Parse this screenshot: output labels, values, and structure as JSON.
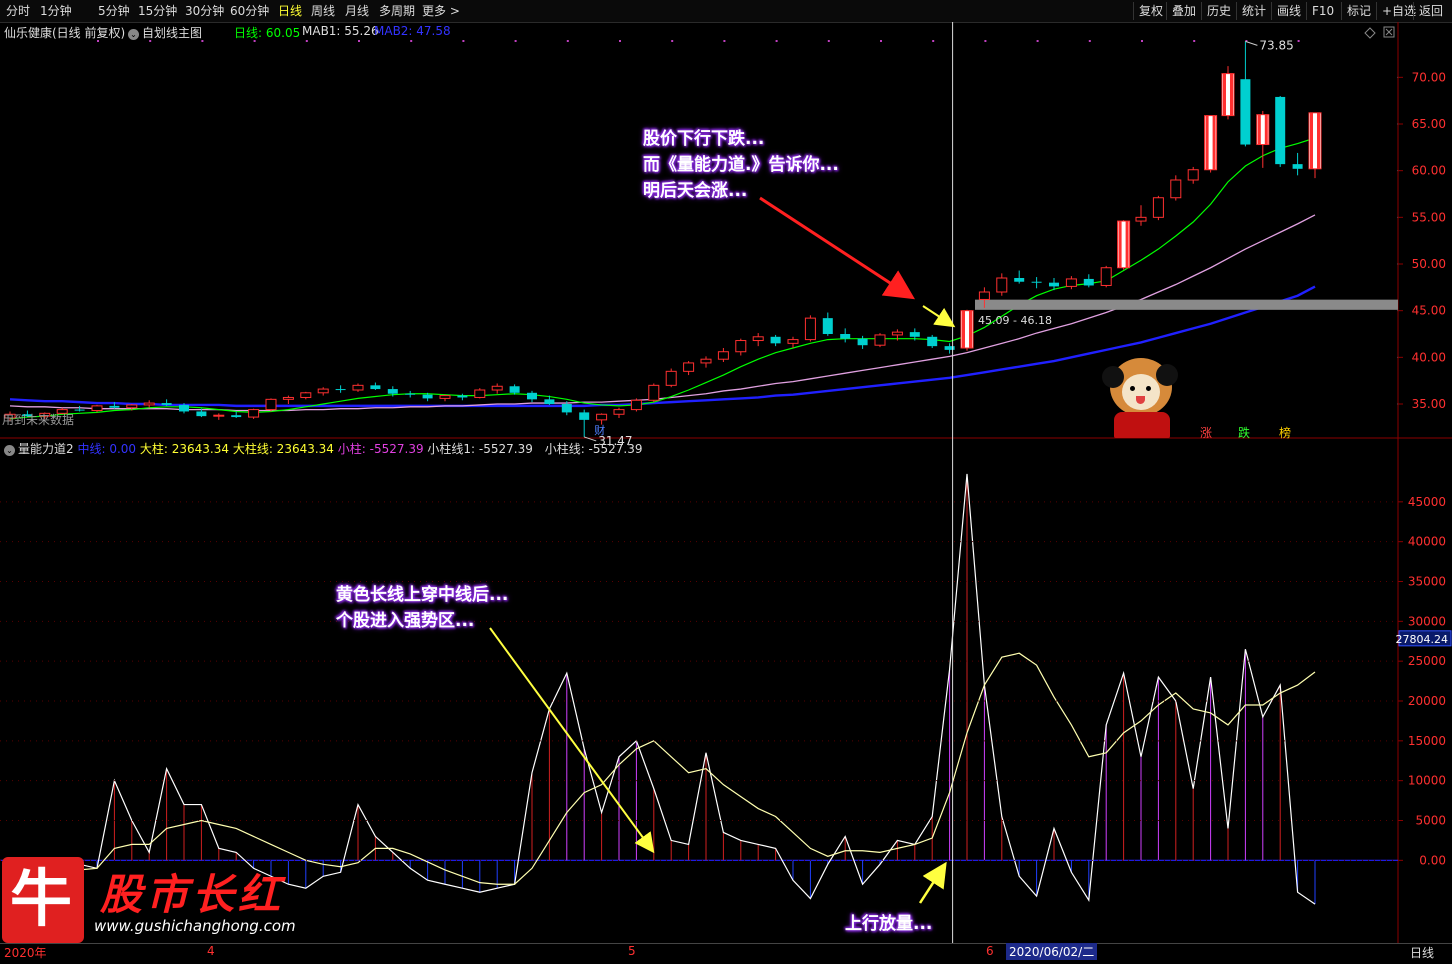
{
  "toolbar": {
    "periods": [
      "分时",
      "1分钟",
      "5分钟",
      "15分钟",
      "30分钟",
      "60分钟",
      "日线",
      "周线",
      "月线",
      "多周期",
      "更多 >"
    ],
    "active": "日线",
    "right": [
      "复权",
      "叠加",
      "历史",
      "统计",
      "画线",
      "F10",
      "标记",
      "+自选",
      "返回"
    ]
  },
  "main_header": {
    "stock": "仙乐健康(日线 前复权)",
    "template": "自划线主图",
    "day_label": "日线:",
    "day_value": "60.05",
    "mab1": "MAB1: 55.26",
    "mab2": "MAB2: 47.58"
  },
  "indicator_header": {
    "name": "量能力道2",
    "mid_label": "中线: 0.00",
    "big_bar": "大柱: 23643.34",
    "big_line": "大柱线: 23643.34",
    "small_bar": "小柱: -5527.39",
    "small_line1": "小柱线1: -5527.39",
    "small_line": "小柱线: -5527.39"
  },
  "labels": {
    "future_data": "用到未来数据",
    "high_mark": "73.85",
    "low_mark": "31.47",
    "cai": "财",
    "range": "45.09 - 46.18",
    "zhang": "涨",
    "die": "跌",
    "bang": "榜",
    "current_indicator": "27804.24",
    "date_year": "2020年",
    "m4": "4",
    "m5": "5",
    "m6": "6",
    "cursor_date": "2020/06/02/二",
    "bottom_right": "日线"
  },
  "annotations": {
    "price_note": [
      "股价下行下跌...",
      "而《量能力道.》告诉你...",
      "明后天会涨..."
    ],
    "yellow_note": [
      "黄色长线上穿中线后...",
      "个股进入强势区..."
    ],
    "up_volume": "上行放量..."
  },
  "logo": {
    "char": "牛",
    "name": "股市长红",
    "url": "www.gushichanghong.com"
  },
  "colors": {
    "up": "#ff3030",
    "down": "#00d0d0",
    "ma_green": "#00ff00",
    "ma_pink": "#e0a0e0",
    "ma_blue": "#2020ff",
    "yellow": "#ffff40"
  },
  "chart_data": [
    {
      "type": "candlestick",
      "title": "仙乐健康(日线 前复权)",
      "ylim": [
        32,
        74
      ],
      "yticks": [
        35,
        40,
        45,
        50,
        55,
        60,
        65,
        70
      ],
      "candles": [
        [
          33.5,
          34.2,
          33.2,
          33.9
        ],
        [
          33.9,
          34.3,
          33.6,
          33.7
        ],
        [
          33.7,
          34.1,
          33.4,
          34.0
        ],
        [
          34.0,
          34.6,
          33.9,
          34.4
        ],
        [
          34.4,
          34.8,
          34.2,
          34.3
        ],
        [
          34.3,
          34.9,
          34.1,
          34.8
        ],
        [
          34.8,
          35.2,
          34.5,
          34.6
        ],
        [
          34.6,
          35.0,
          34.3,
          34.9
        ],
        [
          34.9,
          35.4,
          34.6,
          35.1
        ],
        [
          35.1,
          35.5,
          34.8,
          34.9
        ],
        [
          34.9,
          35.1,
          34.0,
          34.2
        ],
        [
          34.2,
          34.5,
          33.6,
          33.7
        ],
        [
          33.7,
          34.0,
          33.3,
          33.8
        ],
        [
          33.8,
          34.2,
          33.5,
          33.6
        ],
        [
          33.6,
          34.5,
          33.4,
          34.4
        ],
        [
          34.4,
          35.6,
          34.2,
          35.5
        ],
        [
          35.5,
          35.9,
          35.0,
          35.7
        ],
        [
          35.7,
          36.3,
          35.5,
          36.2
        ],
        [
          36.2,
          36.8,
          35.9,
          36.6
        ],
        [
          36.6,
          37.0,
          36.2,
          36.5
        ],
        [
          36.5,
          37.2,
          36.3,
          37.0
        ],
        [
          37.0,
          37.3,
          36.5,
          36.6
        ],
        [
          36.6,
          36.9,
          35.8,
          36.1
        ],
        [
          36.1,
          36.4,
          35.7,
          36.0
        ],
        [
          36.0,
          36.2,
          35.3,
          35.6
        ],
        [
          35.6,
          36.0,
          35.3,
          35.9
        ],
        [
          35.9,
          36.1,
          35.4,
          35.7
        ],
        [
          35.7,
          36.7,
          35.6,
          36.5
        ],
        [
          36.5,
          37.2,
          36.1,
          36.9
        ],
        [
          36.9,
          37.1,
          36.0,
          36.2
        ],
        [
          36.2,
          36.4,
          35.2,
          35.5
        ],
        [
          35.5,
          35.9,
          34.9,
          35.0
        ],
        [
          35.0,
          35.3,
          33.8,
          34.1
        ],
        [
          34.1,
          34.4,
          31.47,
          33.3
        ],
        [
          33.3,
          34.0,
          32.8,
          33.9
        ],
        [
          33.9,
          34.6,
          33.5,
          34.4
        ],
        [
          34.4,
          35.6,
          34.2,
          35.4
        ],
        [
          35.4,
          37.2,
          35.2,
          37.0
        ],
        [
          37.0,
          38.8,
          36.8,
          38.5
        ],
        [
          38.5,
          39.6,
          38.1,
          39.4
        ],
        [
          39.4,
          40.1,
          38.9,
          39.8
        ],
        [
          39.8,
          41.0,
          39.5,
          40.6
        ],
        [
          40.6,
          42.0,
          40.2,
          41.8
        ],
        [
          41.8,
          42.6,
          41.2,
          42.2
        ],
        [
          42.2,
          42.4,
          41.2,
          41.5
        ],
        [
          41.5,
          42.2,
          41.0,
          41.9
        ],
        [
          41.9,
          44.5,
          41.7,
          44.2
        ],
        [
          44.2,
          44.8,
          42.3,
          42.5
        ],
        [
          42.5,
          43.1,
          41.6,
          42.0
        ],
        [
          42.0,
          42.3,
          40.9,
          41.3
        ],
        [
          41.3,
          42.6,
          41.1,
          42.4
        ],
        [
          42.4,
          43.0,
          41.8,
          42.7
        ],
        [
          42.7,
          43.1,
          41.8,
          42.2
        ],
        [
          42.2,
          42.4,
          41.0,
          41.2
        ],
        [
          41.2,
          41.5,
          40.4,
          40.8
        ],
        [
          41.0,
          45.1,
          40.7,
          45.0
        ],
        [
          46.2,
          47.5,
          45.3,
          47.0
        ],
        [
          47.0,
          49.0,
          46.6,
          48.5
        ],
        [
          48.5,
          49.3,
          47.9,
          48.1
        ],
        [
          48.1,
          48.6,
          47.4,
          48.0
        ],
        [
          48.0,
          48.5,
          47.2,
          47.6
        ],
        [
          47.6,
          48.7,
          47.3,
          48.4
        ],
        [
          48.4,
          48.9,
          47.5,
          47.7
        ],
        [
          47.7,
          49.8,
          47.5,
          49.6
        ],
        [
          49.6,
          54.7,
          49.4,
          54.6
        ],
        [
          54.6,
          56.3,
          54.1,
          55.0
        ],
        [
          55.0,
          57.3,
          54.7,
          57.1
        ],
        [
          57.1,
          59.5,
          56.8,
          59.0
        ],
        [
          59.0,
          60.4,
          58.6,
          60.1
        ],
        [
          60.1,
          65.9,
          59.8,
          65.9
        ],
        [
          65.9,
          71.2,
          65.5,
          70.4
        ],
        [
          69.8,
          73.85,
          62.6,
          62.8
        ],
        [
          62.8,
          66.4,
          60.3,
          66.0
        ],
        [
          67.9,
          68.0,
          60.4,
          60.7
        ],
        [
          60.7,
          61.9,
          59.5,
          60.2
        ],
        [
          60.2,
          66.2,
          59.2,
          66.2
        ]
      ],
      "series": [
        {
          "name": "MAB1",
          "values": [
            33.4,
            33.6,
            33.7,
            33.9,
            34.0,
            34.1,
            34.3,
            34.4,
            34.6,
            34.7,
            34.7,
            34.6,
            34.4,
            34.2,
            34.1,
            34.2,
            34.4,
            34.7,
            35.0,
            35.3,
            35.6,
            35.8,
            36.0,
            36.1,
            36.1,
            36.0,
            35.9,
            35.9,
            36.0,
            36.1,
            36.0,
            35.8,
            35.5,
            35.1,
            34.9,
            34.8,
            34.9,
            35.2,
            35.8,
            36.5,
            37.3,
            38.1,
            39.0,
            39.8,
            40.5,
            41.0,
            41.5,
            41.9,
            42.0,
            42.0,
            42.0,
            42.0,
            42.0,
            41.9,
            41.7,
            42.3,
            43.2,
            44.4,
            45.6,
            46.6,
            47.3,
            47.7,
            47.9,
            48.2,
            49.3,
            50.4,
            51.6,
            53.0,
            54.5,
            56.4,
            58.8,
            60.5,
            61.6,
            62.4,
            62.9,
            63.5
          ]
        },
        {
          "name": "MAB2",
          "values": [
            34.8,
            34.7,
            34.7,
            34.6,
            34.6,
            34.5,
            34.5,
            34.5,
            34.5,
            34.5,
            34.4,
            34.4,
            34.4,
            34.3,
            34.3,
            34.3,
            34.3,
            34.4,
            34.4,
            34.5,
            34.5,
            34.6,
            34.6,
            34.7,
            34.7,
            34.8,
            34.8,
            34.9,
            35.0,
            35.0,
            35.1,
            35.1,
            35.1,
            35.2,
            35.2,
            35.3,
            35.4,
            35.5,
            35.7,
            35.9,
            36.1,
            36.4,
            36.6,
            36.9,
            37.2,
            37.4,
            37.7,
            38.0,
            38.3,
            38.6,
            38.9,
            39.2,
            39.5,
            39.8,
            40.1,
            40.5,
            41.0,
            41.5,
            42.0,
            42.6,
            43.1,
            43.6,
            44.2,
            44.8,
            45.5,
            46.2,
            47.0,
            47.8,
            48.7,
            49.6,
            50.6,
            51.6,
            52.5,
            53.4,
            54.3,
            55.26
          ]
        },
        {
          "name": "日线",
          "values": [
            35.5,
            35.4,
            35.3,
            35.3,
            35.2,
            35.1,
            35.1,
            35.0,
            35.0,
            34.9,
            34.9,
            34.9,
            34.9,
            34.8,
            34.8,
            34.8,
            34.8,
            34.8,
            34.8,
            34.8,
            34.8,
            34.8,
            34.8,
            34.8,
            34.8,
            34.8,
            34.8,
            34.8,
            34.8,
            34.8,
            34.8,
            34.8,
            34.8,
            34.8,
            34.9,
            34.9,
            35.0,
            35.1,
            35.2,
            35.3,
            35.4,
            35.5,
            35.6,
            35.7,
            35.9,
            36.0,
            36.2,
            36.4,
            36.6,
            36.8,
            37.0,
            37.2,
            37.4,
            37.6,
            37.8,
            38.1,
            38.4,
            38.7,
            39.0,
            39.3,
            39.6,
            40.0,
            40.4,
            40.8,
            41.2,
            41.6,
            42.1,
            42.6,
            43.1,
            43.6,
            44.2,
            44.8,
            45.4,
            46.0,
            46.6,
            47.58
          ]
        }
      ]
    },
    {
      "type": "bar",
      "title": "量能力道2",
      "ylim": [
        -10000,
        50000
      ],
      "yticks": [
        0,
        5000,
        10000,
        15000,
        20000,
        25000,
        30000,
        35000,
        40000,
        45000
      ],
      "values": [
        -2500,
        -2000,
        -1500,
        -1000,
        -500,
        -1000,
        10000,
        5000,
        1000,
        11500,
        7000,
        7000,
        1500,
        1000,
        -1000,
        -2000,
        -3000,
        -3500,
        -2000,
        -1500,
        7000,
        3000,
        1000,
        -1000,
        -2500,
        -3000,
        -3500,
        -4000,
        -3500,
        -3000,
        11000,
        19000,
        23500,
        14000,
        6000,
        13000,
        15000,
        9000,
        2500,
        2000,
        13500,
        3500,
        2500,
        2000,
        1500,
        -2500,
        -4800,
        -500,
        3000,
        -3000,
        -500,
        2500,
        2000,
        5500,
        24000,
        48500,
        22000,
        5500,
        -2000,
        -4500,
        4000,
        -1500,
        -5000,
        17000,
        23500,
        13000,
        23000,
        20000,
        9000,
        23000,
        4000,
        26500,
        18000,
        22000,
        -4000,
        -5500
      ],
      "series": [
        {
          "name": "大柱线",
          "values": [
            -2000,
            -1800,
            -1600,
            -1400,
            -1200,
            -1000,
            1500,
            2000,
            2000,
            4000,
            4500,
            5000,
            4500,
            4000,
            3000,
            2000,
            1000,
            0,
            -500,
            -800,
            -300,
            1500,
            1500,
            800,
            -200,
            -1200,
            -2000,
            -2800,
            -3000,
            -3000,
            -1000,
            2500,
            6000,
            8500,
            9500,
            12000,
            14000,
            15000,
            13000,
            11000,
            11500,
            9500,
            8000,
            6500,
            5500,
            3500,
            1500,
            500,
            1200,
            1200,
            1000,
            1500,
            2000,
            2800,
            8500,
            16000,
            22000,
            25500,
            26000,
            24500,
            20500,
            17000,
            13000,
            13500,
            16000,
            17500,
            19500,
            21000,
            19000,
            18500,
            17000,
            19500,
            19500,
            21000,
            22000,
            23643.34
          ]
        }
      ]
    }
  ]
}
